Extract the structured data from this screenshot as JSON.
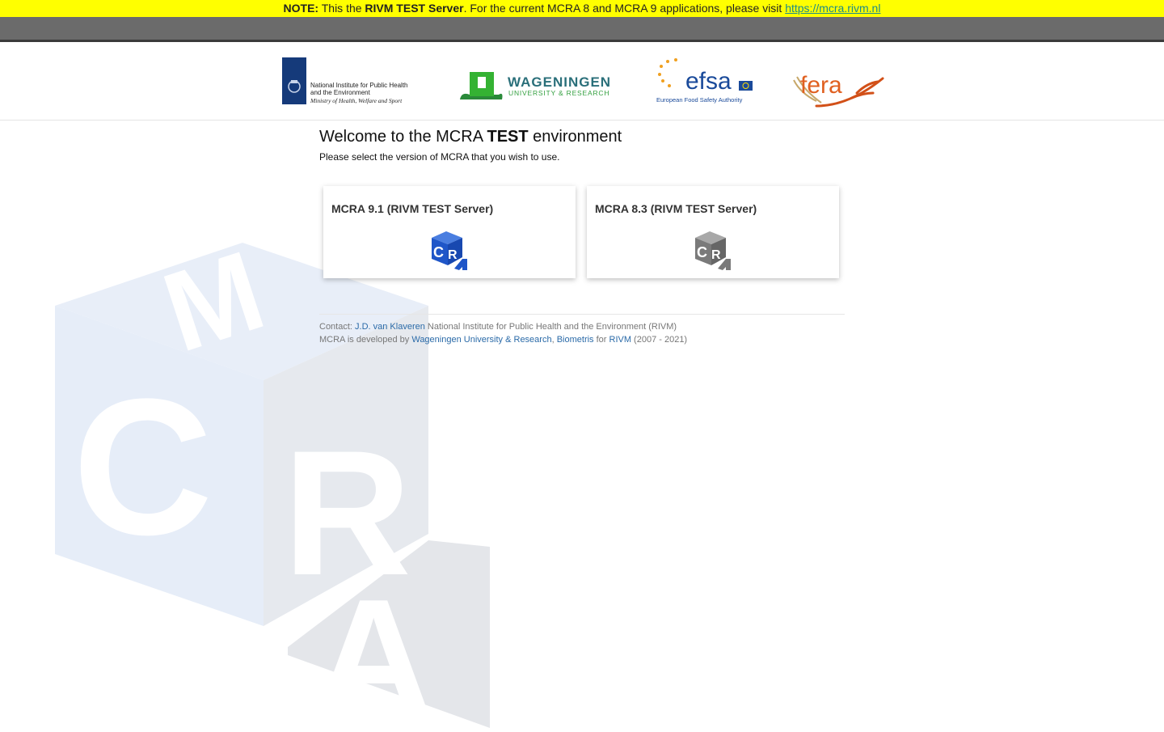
{
  "notice": {
    "note_label": "NOTE:",
    "text1": " This the ",
    "server_bold": "RIVM TEST Server",
    "text2": ". For the current MCRA 8 and MCRA 9 applications, please visit ",
    "link": "https://mcra.rivm.nl"
  },
  "logos": {
    "rivm": {
      "line1": "National Institute for Public Health",
      "line2": "and the Environment",
      "line3": "Ministry of Health, Welfare and Sport"
    },
    "wur": {
      "name": "WAGENINGEN",
      "sub": "UNIVERSITY & RESEARCH"
    },
    "efsa": {
      "name": "efsa",
      "sub": "European Food Safety Authority"
    },
    "fera": {
      "name": "fera"
    }
  },
  "welcome": {
    "pre": "Welcome to the MCRA ",
    "bold": "TEST",
    "post": " environment"
  },
  "subtitle": "Please select the version of MCRA that you wish to use.",
  "cards": [
    {
      "title": "MCRA 9.1 (RIVM TEST Server)",
      "icon_color": "#1f56c8"
    },
    {
      "title": "MCRA 8.3 (RIVM TEST Server)",
      "icon_color": "#7a7a7a"
    }
  ],
  "footer": {
    "contact_label": "Contact: ",
    "contact_name": "J.D. van Klaveren",
    "contact_org": " National Institute for Public Health and the Environment (RIVM)",
    "dev_label": "MCRA is developed by ",
    "dev_link1": "Wageningen University & Research",
    "comma": ", ",
    "dev_link2": "Biometris",
    "for": " for ",
    "dev_link3": "RIVM",
    "years": " (2007 - 2021)"
  },
  "background_cube": {
    "letters": [
      "M",
      "C",
      "R",
      "A"
    ]
  }
}
